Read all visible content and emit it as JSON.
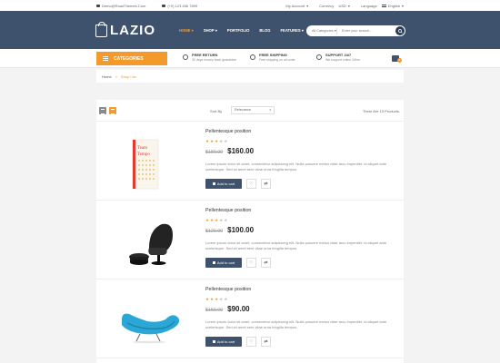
{
  "topbar": {
    "email": "Demo@RoadThemes.Com",
    "phone": "(+0) 123 456 7899",
    "account": "My Account",
    "currency_label": "Currency",
    "currency_value": "USD",
    "language_label": "Language",
    "language_value": "English"
  },
  "header": {
    "logo": "LAZIO",
    "nav": [
      {
        "label": "HOME",
        "active": true
      },
      {
        "label": "SHOP",
        "active": false
      },
      {
        "label": "PORTFOLIO",
        "active": false
      },
      {
        "label": "BLOG",
        "active": false
      },
      {
        "label": "FEATURES",
        "active": false
      }
    ],
    "search_category": "All Categories",
    "search_placeholder": "Enter your search..."
  },
  "service": {
    "categories_label": "CATEGORIES",
    "items": [
      {
        "title": "FREE RETURN",
        "subtitle": "30 days money back guarantee"
      },
      {
        "title": "FREE SHIPPING",
        "subtitle": "Free shipping on all order"
      },
      {
        "title": "SUPPORT 24/7",
        "subtitle": "We support online 24hrs"
      }
    ],
    "cart_count": "0"
  },
  "breadcrumb": {
    "home": "Home",
    "separator": "»",
    "current": "Shop List"
  },
  "toolbar": {
    "sort_label": "Sort By",
    "sort_value": "Relevance",
    "count": "There Are 13 Products."
  },
  "products": [
    {
      "name": "Pellentesque position",
      "rating": 3,
      "old_price": "$180.00",
      "price": "$160.00",
      "description": "Lorem ipsum dolor sit amet, consectetur adipisicing elit. Nulla posuere metus vitae arcu imperdiet, id aliquet ante scelerisque. Sed sit amet sem vitae urna fringilla tempus.",
      "add_to_cart": "Add to cart",
      "book_title_1": "Team",
      "book_title_2": "Tempo"
    },
    {
      "name": "Pellentesque position",
      "rating": 3,
      "old_price": "$120.00",
      "price": "$100.00",
      "description": "Lorem ipsum dolor sit amet, consectetur adipisicing elit. Nulla posuere metus vitae arcu imperdiet, id aliquet ante scelerisque. Sed sit amet sem vitae urna fringilla tempus.",
      "add_to_cart": "Add to cart"
    },
    {
      "name": "Pellentesque position",
      "rating": 3,
      "old_price": "$150.00",
      "price": "$90.00",
      "description": "Lorem ipsum dolor sit amet, consectetur adipisicing elit. Nulla posuere metus vitae arcu imperdiet, id aliquet ante scelerisque. Sed sit amet sem vitae urna fringilla tempus.",
      "add_to_cart": "Add to cart"
    }
  ],
  "colors": {
    "header": "#3f526d",
    "accent": "#f39a2b",
    "background": "#f3f3f3"
  }
}
